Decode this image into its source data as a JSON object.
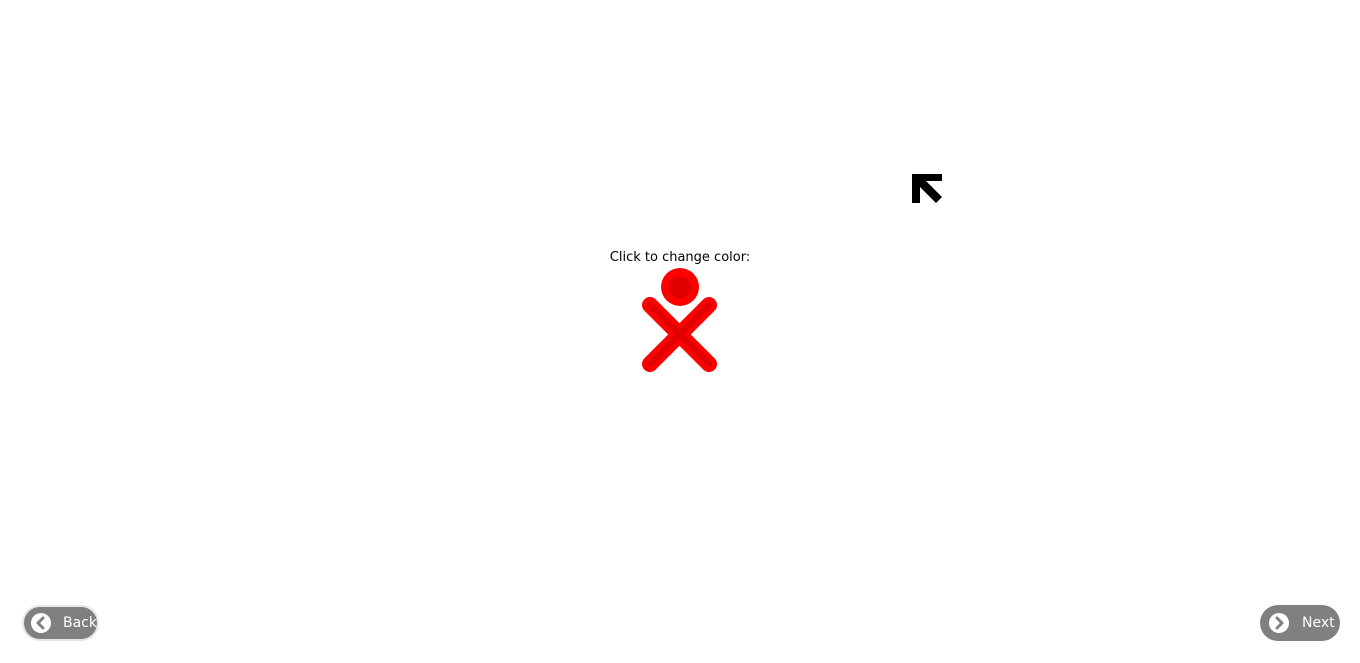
{
  "prompt": {
    "text": "Click to change color:"
  },
  "xo_icon": {
    "name": "xo-icon",
    "stroke_color": "#ff0000",
    "fill_color": "#e00000"
  },
  "pointer": {
    "name": "arrow-up-left-icon",
    "color": "#000000"
  },
  "navigation": {
    "back_label": "Back",
    "next_label": "Next",
    "button_color": "#808080",
    "back_icon": "chevron-left-icon",
    "next_icon": "chevron-right-icon"
  }
}
